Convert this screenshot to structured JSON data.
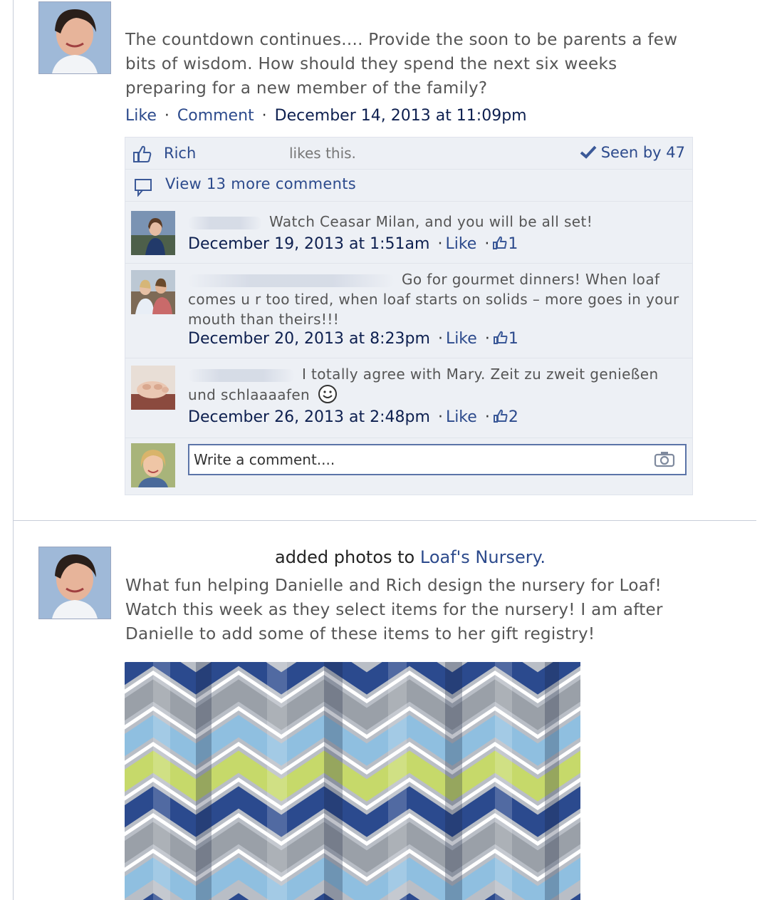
{
  "post1": {
    "text": "The countdown continues.... Provide the soon to be parents a few bits of wisdom. How should they spend the next six weeks preparing for a new member of the family?",
    "actions": {
      "like": "Like",
      "comment": "Comment",
      "separator": "·",
      "timestamp": "December 14, 2013 at 11:09pm"
    },
    "likes": {
      "name": "Rich",
      "suffix": "likes this.",
      "seen": "Seen by 47"
    },
    "view_more": "View 13 more comments",
    "comments": [
      {
        "text": "Watch Ceasar Milan, and you will be all set!",
        "time": "December 19, 2013 at 1:51am",
        "like": "Like",
        "count": "1"
      },
      {
        "text": "Go for gourmet dinners! When loaf comes u r too tired, when loaf starts on solids – more goes in your mouth than theirs!!!",
        "time": "December 20, 2013 at 8:23pm",
        "like": "Like",
        "count": "1"
      },
      {
        "text": "I totally agree with Mary. Zeit zu zweit genießen und schlaaaafen",
        "time": "December 26, 2013 at 2:48pm",
        "like": "Like",
        "count": "2"
      }
    ],
    "write_placeholder": "Write a comment...."
  },
  "post2": {
    "added": "added photos to",
    "album": "Loaf's Nursery.",
    "text": "What fun helping Danielle and Rich design the nursery for Loaf! Watch this week as they select items for the nursery! I am after Danielle to add some of these items to her gift registry!"
  },
  "colors": {
    "link": "#2c4a8c",
    "meta": "#0d1f4f",
    "box_bg": "#edf0f5",
    "chevron_navy": "#2b4a8e",
    "chevron_light_blue": "#8fbfe0",
    "chevron_lime": "#c6d96a",
    "chevron_gray": "#9aa0a8"
  },
  "icons": [
    "like-thumb-icon",
    "checkmark-icon",
    "comment-bubble-icon",
    "camera-icon",
    "smiley-icon"
  ]
}
